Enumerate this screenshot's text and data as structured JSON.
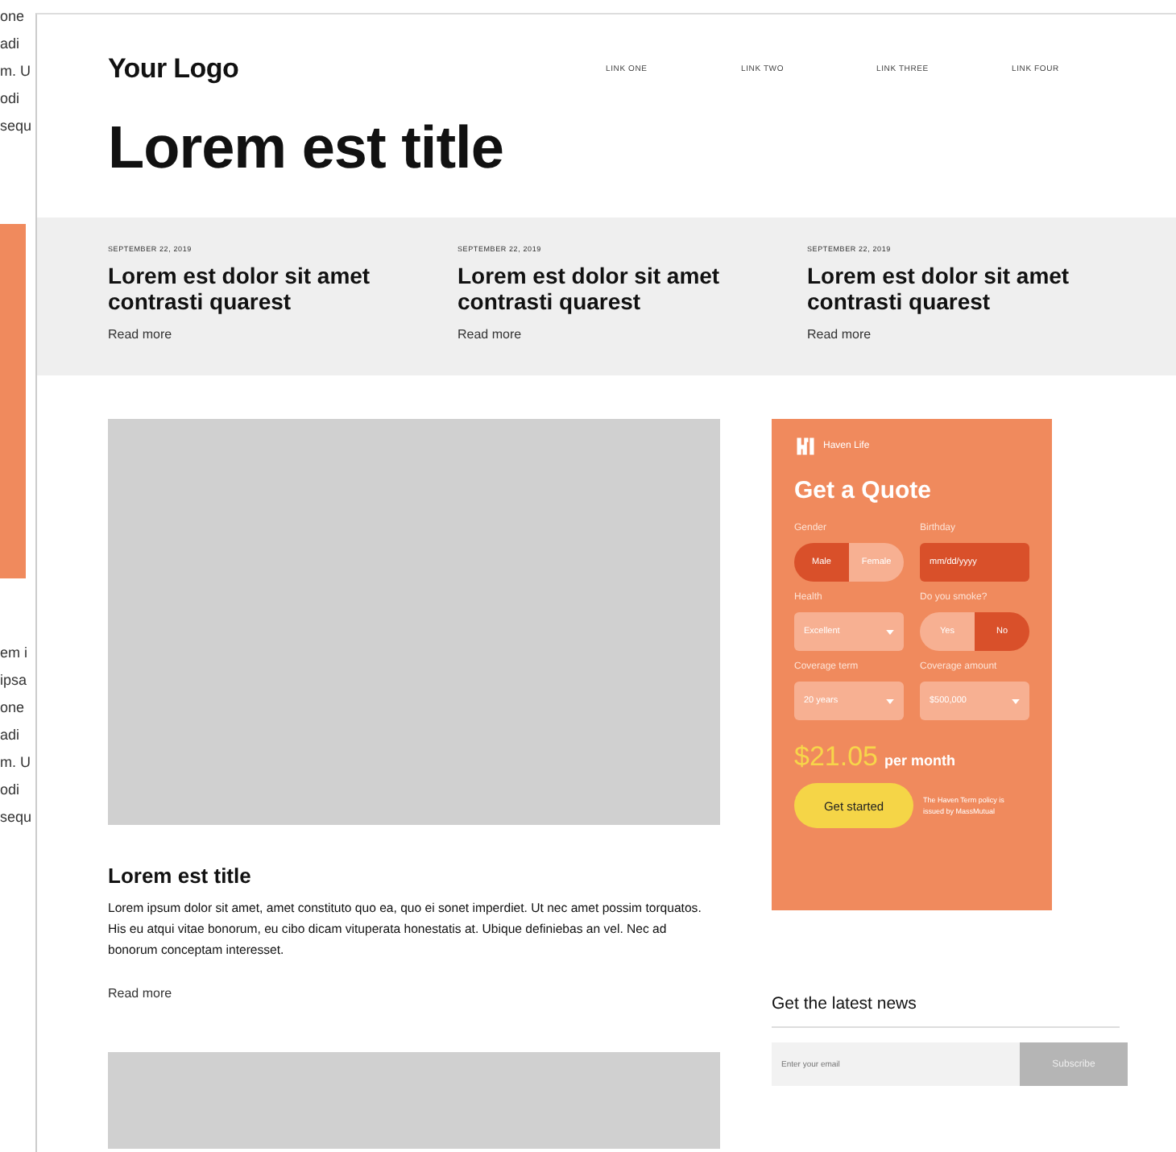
{
  "background_page": {
    "top_lines": [
      "one",
      "adi",
      "m. U",
      "odi",
      "sequ"
    ],
    "bottom_lines": [
      "em i",
      "ipsa",
      "one",
      "adi",
      "m. U",
      "odi",
      "sequ"
    ]
  },
  "header": {
    "logo": "Your Logo",
    "links": [
      "LINK ONE",
      "LINK TWO",
      "LINK THREE",
      "LINK FOUR"
    ]
  },
  "page_title": "Lorem est title",
  "featured": [
    {
      "date": "SEPTEMBER 22, 2019",
      "title": "Lorem est dolor sit amet contrasti quarest",
      "link": "Read more"
    },
    {
      "date": "SEPTEMBER 22, 2019",
      "title": "Lorem est dolor sit amet contrasti quarest",
      "link": "Read more"
    },
    {
      "date": "SEPTEMBER 22, 2019",
      "title": "Lorem est dolor sit amet contrasti quarest",
      "link": "Read more"
    }
  ],
  "article": {
    "title": "Lorem est title",
    "body": "Lorem ipsum dolor sit amet, amet constituto quo ea, quo ei sonet imperdiet. Ut nec amet possim torquatos. His eu atqui vitae bonorum, eu cibo dicam vituperata honestatis at. Ubique definiebas an vel. Nec ad bonorum conceptam interesset.",
    "link": "Read more"
  },
  "quote": {
    "brand": "Haven Life",
    "title": "Get a Quote",
    "fields": [
      {
        "kind": "toggle",
        "label": "Gender",
        "options": [
          {
            "label": "Male",
            "selected": true
          },
          {
            "label": "Female",
            "selected": false
          }
        ]
      },
      {
        "kind": "input",
        "label": "Birthday",
        "value": "mm/dd/yyyy"
      },
      {
        "kind": "select",
        "label": "Health",
        "value": "Excellent"
      },
      {
        "kind": "toggle",
        "label": "Do you smoke?",
        "options": [
          {
            "label": "Yes",
            "selected": false
          },
          {
            "label": "No",
            "selected": true
          }
        ]
      },
      {
        "kind": "select",
        "label": "Coverage term",
        "value": "20 years"
      },
      {
        "kind": "select",
        "label": "Coverage amount",
        "value": "$500,000"
      }
    ],
    "price": "$21.05",
    "period": "per month",
    "button": "Get started",
    "note": "The Haven Term policy is issued by MassMutual"
  },
  "newsletter": {
    "title": "Get the latest news",
    "placeholder": "Enter your email",
    "button": "Subscribe"
  }
}
